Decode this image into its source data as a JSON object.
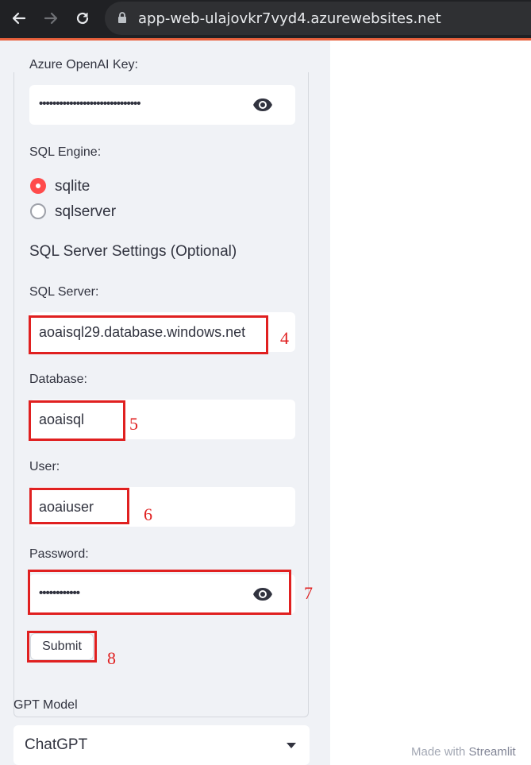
{
  "browser": {
    "url": "app-web-ulajovkr7vyd4.azurewebsites.net",
    "icons": [
      "back-arrow-icon",
      "forward-arrow-icon",
      "reload-icon",
      "lock-icon"
    ]
  },
  "form": {
    "openai_key_label": "Azure OpenAI Key:",
    "openai_key_masked": "••••••••••••••••••••••••••••••",
    "sql_engine_label": "SQL Engine:",
    "sql_engine_options": [
      "sqlite",
      "sqlserver"
    ],
    "sql_engine_selected": "sqlite",
    "sql_settings_title": "SQL Server Settings (Optional)",
    "sql_server_label": "SQL Server:",
    "sql_server_value": "aoaisql29.database.windows.net",
    "database_label": "Database:",
    "database_value": "aoaisql",
    "user_label": "User:",
    "user_value": "aoaiuser",
    "password_label": "Password:",
    "password_masked": "••••••••••••",
    "submit_label": "Submit"
  },
  "annotations": [
    "4",
    "5",
    "6",
    "7",
    "8"
  ],
  "gpt_model": {
    "label": "GPT Model",
    "selected": "ChatGPT"
  },
  "footer": {
    "prefix": "Made with",
    "brand": "Streamlit"
  },
  "colors": {
    "accent": "#ff4b4b",
    "annotation_red": "#e02020",
    "sidebar_bg": "#f0f2f6"
  }
}
